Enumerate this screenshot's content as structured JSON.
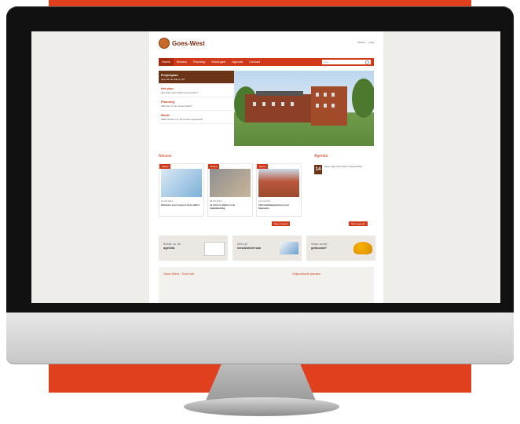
{
  "site": {
    "logo_text": "Goes-West",
    "logo_subtitle": "",
    "top_links": [
      "Zoeken",
      "Inlog"
    ],
    "nav": [
      "Home",
      "Nieuws",
      "Planning",
      "Woningen",
      "Agenda",
      "Contact"
    ],
    "search_placeholder": "Zoek",
    "hero_menu": [
      {
        "title": "Projectplan",
        "sub": "Hoe ziet de wijk er uit?"
      },
      {
        "title": "Het plan",
        "sub": "Hoe komt Goes-West eruit te zien?"
      },
      {
        "title": "Planning",
        "sub": "Wanneer is het nieuwe klaar?"
      },
      {
        "title": "Bouw",
        "sub": "Waar wordt er op dit moment gebouwd?"
      }
    ],
    "news_heading": "Nieuws",
    "news": [
      {
        "badge": "Nieuw",
        "date": "01-06-2013",
        "title": "Startsein voor bouw in Goes-West"
      },
      {
        "badge": "Nieuw",
        "date": "08-05-2013",
        "title": "Je kunt nu kijken in de modelwoning"
      },
      {
        "badge": "Nieuw",
        "date": "22-04-2013",
        "title": "Informatiebijeenkomst voor bewoners"
      }
    ],
    "news_more": "Meer nieuws",
    "agenda_heading": "Agenda",
    "agenda": [
      {
        "day": "14",
        "text": "Open dag\nGoes-West in Goes-West"
      }
    ],
    "agenda_more": "Meer agenda",
    "promos": [
      {
        "line1": "Bekijk nu de",
        "line2": "agenda"
      },
      {
        "line1": "Meld je",
        "line2": "nieuwsbrief aan"
      },
      {
        "line1": "Waar wordt",
        "line2": "gebouwd?"
      }
    ],
    "bottom_left": "Goes-West - Tour met",
    "bottom_right": "Vrijwonende panden"
  },
  "colors": {
    "accent": "#d03a1a",
    "brown": "#6b3416",
    "background_red": "#e0401e"
  }
}
